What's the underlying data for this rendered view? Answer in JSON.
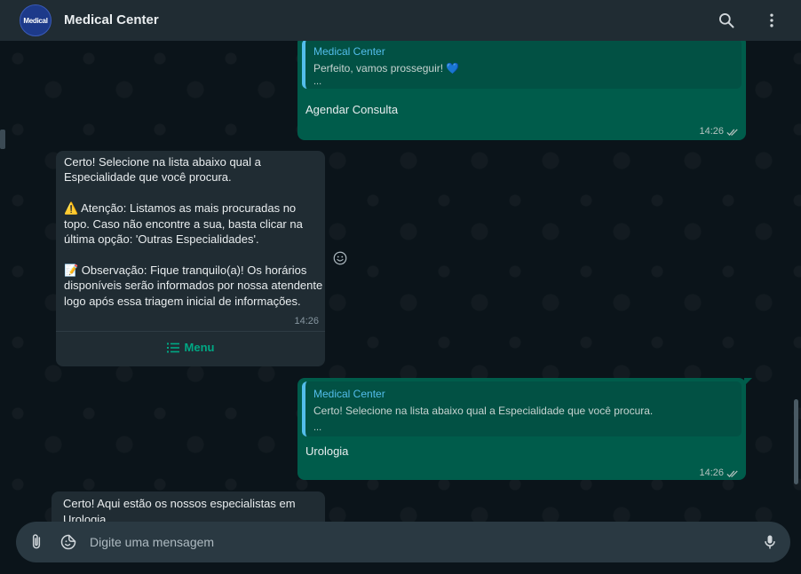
{
  "header": {
    "avatar_text": "Medical",
    "title": "Medical Center",
    "icons": [
      "search-icon",
      "menu-kebab-icon"
    ]
  },
  "messages": [
    {
      "direction": "out",
      "quote_name": "Medical Center",
      "quote_text": "Perfeito, vamos prosseguir! 💙",
      "quote_dots": "...",
      "text": "Agendar Consulta",
      "time": "14:26"
    },
    {
      "direction": "in",
      "line1": "Certo! Selecione na lista abaixo qual a",
      "line2": "Especialidade que você procura.",
      "line3": "⚠️ Atenção: Listamos as mais procuradas no",
      "line4": "topo. Caso não encontre a sua, basta clicar na",
      "line5": "última opção: 'Outras Especialidades'.",
      "line6": "📝 Observação: Fique tranquilo(a)! Os horários",
      "line7": "disponíveis serão informados por nossa atendente",
      "line8": "logo após essa triagem inicial de informações.",
      "time": "14:26",
      "menu_label": "Menu"
    },
    {
      "direction": "out",
      "quote_name": "Medical Center",
      "quote_text": "Certo! Selecione na lista abaixo qual a Especialidade que você procura.",
      "quote_dots": "...",
      "text": "Urologia",
      "time": "14:26"
    },
    {
      "direction": "in",
      "line1": "Certo! Aqui estão os nossos especialistas em",
      "line2": "Urologia."
    }
  ],
  "composer": {
    "placeholder": "Digite uma mensagem",
    "icons": [
      "attach-icon",
      "sticker-icon",
      "microphone-icon"
    ]
  },
  "colors": {
    "outgoing_bubble": "#005c4b",
    "incoming_bubble": "#202c33",
    "accent": "#00a884",
    "quote_name": "#53bdeb"
  }
}
